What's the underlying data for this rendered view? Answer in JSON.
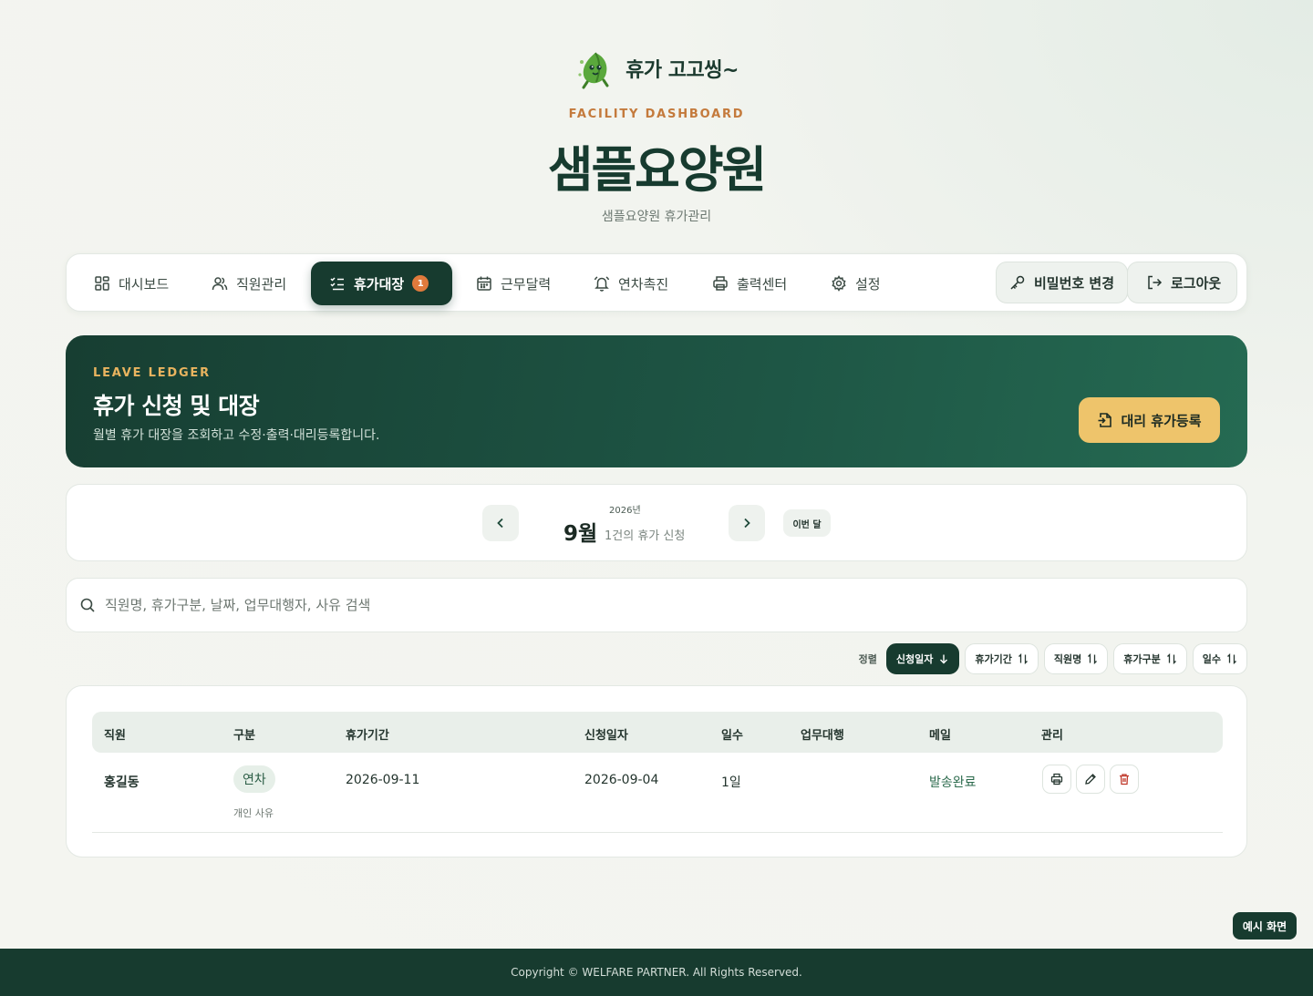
{
  "brand": {
    "name": "휴가 고고씽~",
    "logo_icon": "leaf-mascot-icon"
  },
  "header": {
    "eyebrow": "FACILITY DASHBOARD",
    "facility_name": "샘플요양원",
    "subtitle": "샘플요양원 휴가관리"
  },
  "nav": {
    "items": [
      {
        "label": "대시보드",
        "icon": "grid-icon",
        "active": false
      },
      {
        "label": "직원관리",
        "icon": "users-icon",
        "active": false
      },
      {
        "label": "휴가대장",
        "icon": "checklist-icon",
        "active": true,
        "badge": "1"
      },
      {
        "label": "근무달력",
        "icon": "calendar-icon",
        "active": false
      },
      {
        "label": "연차촉진",
        "icon": "bell-icon",
        "active": false
      },
      {
        "label": "출력센터",
        "icon": "printer-icon",
        "active": false
      },
      {
        "label": "설정",
        "icon": "gear-icon",
        "active": false
      }
    ],
    "change_password": "비밀번호 변경",
    "logout": "로그아웃"
  },
  "hero": {
    "eyebrow": "LEAVE LEDGER",
    "title": "휴가 신청 및 대장",
    "description": "월별 휴가 대장을 조회하고 수정·출력·대리등록합니다.",
    "proxy_button": "대리 휴가등록"
  },
  "month_nav": {
    "year": "2026년",
    "month": "9월",
    "count_text": "1건의 휴가 신청",
    "this_month": "이번 달"
  },
  "search": {
    "placeholder": "직원명, 휴가구분, 날짜, 업무대행자, 사유 검색",
    "value": ""
  },
  "sort": {
    "label": "정렬",
    "options": [
      {
        "label": "신청일자",
        "active": true,
        "direction": "desc"
      },
      {
        "label": "휴가기간",
        "active": false
      },
      {
        "label": "직원명",
        "active": false
      },
      {
        "label": "휴가구분",
        "active": false
      },
      {
        "label": "일수",
        "active": false
      }
    ]
  },
  "table": {
    "columns": [
      "직원",
      "구분",
      "휴가기간",
      "신청일자",
      "일수",
      "업무대행",
      "메일",
      "관리"
    ],
    "rows": [
      {
        "employee": "홍길동",
        "type": "연차",
        "reason": "개인 사유",
        "period": "2026-09-11",
        "applied": "2026-09-04",
        "days": "1일",
        "proxy": "",
        "mail": "발송완료"
      }
    ]
  },
  "demo_badge": "예시 화면",
  "footer": "Copyright © WELFARE PARTNER. All Rights Reserved.",
  "colors": {
    "primary": "#173b2f",
    "accent": "#e07a3c",
    "gold": "#eec46b",
    "eyebrow": "#c47a3c"
  }
}
